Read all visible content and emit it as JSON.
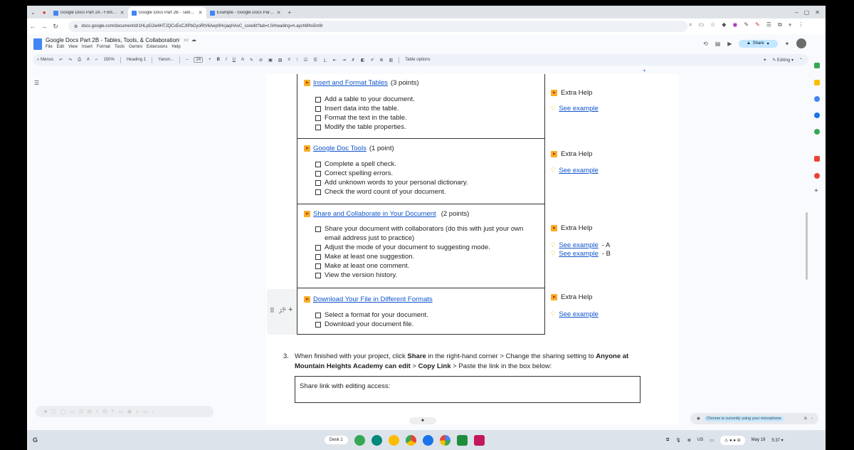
{
  "browser": {
    "tabs": [
      {
        "title": "Google Docs Part 2A - Fonts, I..."
      },
      {
        "title": "Google Docs Part 2B - Tables, ..."
      },
      {
        "title": "Example - Google Docs Part 2..."
      }
    ],
    "url": "docs.google.com/document/d/1HLpG2w4HTJQCxExCJtPbGyoRtV6Aep0HcjaqHAxC_so/edit?tab=t.0#heading=h.aychl8hs5m9r"
  },
  "docs": {
    "title": "Google Docs Part 2B - Tables, Tools, & Collaboration",
    "menu": [
      "File",
      "Edit",
      "View",
      "Insert",
      "Format",
      "Tools",
      "Gemini",
      "Extensions",
      "Help"
    ],
    "share_label": "Share"
  },
  "toolbar": {
    "menus_label": "Menus",
    "zoom": "150%",
    "style": "Heading 1",
    "font": "Yanon...",
    "font_size": "24",
    "table_options": "Table options",
    "editing": "Editing"
  },
  "table": {
    "extra_help": "Extra Help",
    "see_example": "See example",
    "rows": [
      {
        "title": "Insert and Format Tables",
        "points": "(3 points)",
        "items": [
          "Add a table to your document.",
          "Insert data into the table.",
          "Format the text in the table.",
          "Modify the table properties."
        ]
      },
      {
        "title": "Google Doc Tools",
        "points": "(1 point)",
        "items": [
          "Complete a spell check.",
          "Correct spelling errors.",
          "Add unknown words to your personal dictionary.",
          "Check the word count of your document."
        ]
      },
      {
        "title": "Share and Collaborate in Your Document",
        "points": "(2 points)",
        "items": [
          "Share your document with collaborators (do this with just your own email address just to practice)",
          "Adjust the mode of your document to suggesting mode.",
          "Make at least one suggestion.",
          "Make at least one comment.",
          "View the version history."
        ],
        "example_a_suffix": "- A",
        "example_b_suffix": "- B"
      },
      {
        "title": "Download Your File in Different Formats",
        "points": "",
        "items": [
          "Select a format for your document.",
          "Download your document file."
        ]
      }
    ]
  },
  "step3": {
    "number": "3.",
    "t1": "When finished with your project, click ",
    "b1": "Share",
    "t2": " in the right-hand corner > Change the sharing setting to ",
    "b2": "Anyone at Mountain Heights Academy can edit",
    "t3": " > ",
    "b3": "Copy Link",
    "t4": " > Paste the link in the box below:"
  },
  "link_box_label": "Share link with editing access:",
  "mic_notice": "Chrome is currently using your microphone",
  "shelf": {
    "desk": "Desk 1",
    "region": "US",
    "date": "May 19",
    "time": "5:37"
  },
  "colors": {
    "link": "#1155cc",
    "accent": "#f6b026",
    "share_bg": "#c2e7ff"
  }
}
